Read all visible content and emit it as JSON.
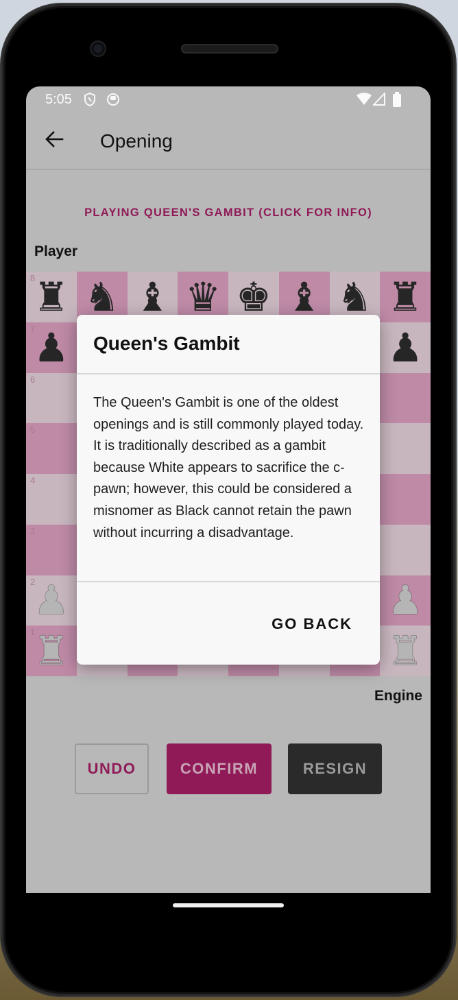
{
  "status_bar": {
    "time": "5:05"
  },
  "app_bar": {
    "title": "Opening"
  },
  "opening_link": "PLAYING QUEEN'S GAMBIT  (CLICK FOR INFO)",
  "top_player_label": "Player",
  "bottom_player_label": "Engine",
  "board": {
    "rank_labels": [
      "8",
      "7",
      "6",
      "5",
      "4",
      "3",
      "2",
      "1"
    ],
    "rows": [
      [
        "♜",
        "♞",
        "♝",
        "♛",
        "♚",
        "♝",
        "♞",
        "♜"
      ],
      [
        "♟",
        "",
        "",
        "",
        "",
        "",
        "",
        "♟"
      ],
      [
        "",
        "",
        "",
        "",
        "",
        "",
        "",
        ""
      ],
      [
        "",
        "",
        "",
        "",
        "",
        "",
        "",
        ""
      ],
      [
        "",
        "",
        "",
        "",
        "",
        "",
        "",
        ""
      ],
      [
        "",
        "",
        "",
        "",
        "",
        "",
        "",
        ""
      ],
      [
        "♟",
        "",
        "",
        "",
        "",
        "",
        "",
        "♟"
      ],
      [
        "♜",
        "",
        "",
        "",
        "",
        "",
        "",
        "♜"
      ]
    ],
    "colors": [
      [
        "b",
        "b",
        "b",
        "b",
        "b",
        "b",
        "b",
        "b"
      ],
      [
        "b",
        "",
        "",
        "",
        "",
        "",
        "",
        "b"
      ],
      [
        "",
        "",
        "",
        "",
        "",
        "",
        "",
        ""
      ],
      [
        "",
        "",
        "",
        "",
        "",
        "",
        "",
        ""
      ],
      [
        "",
        "",
        "",
        "",
        "",
        "",
        "",
        ""
      ],
      [
        "",
        "",
        "",
        "",
        "",
        "",
        "",
        ""
      ],
      [
        "w",
        "",
        "",
        "",
        "",
        "",
        "",
        "w"
      ],
      [
        "w",
        "",
        "",
        "",
        "",
        "",
        "",
        "w"
      ]
    ]
  },
  "buttons": {
    "undo": "UNDO",
    "confirm": "CONFIRM",
    "resign": "RESIGN"
  },
  "dialog": {
    "title": "Queen's Gambit",
    "body": "The Queen's Gambit is one of the oldest openings and is still commonly played today. It is traditionally described as a gambit because White appears to sacrifice the c-pawn; however, this could be considered a misnomer as Black cannot retain the pawn without incurring a disadvantage.",
    "action": "GO BACK"
  },
  "colors": {
    "accent": "#8f1a57",
    "board_light": "#c8b6bf",
    "board_dark": "#be8aa6"
  }
}
